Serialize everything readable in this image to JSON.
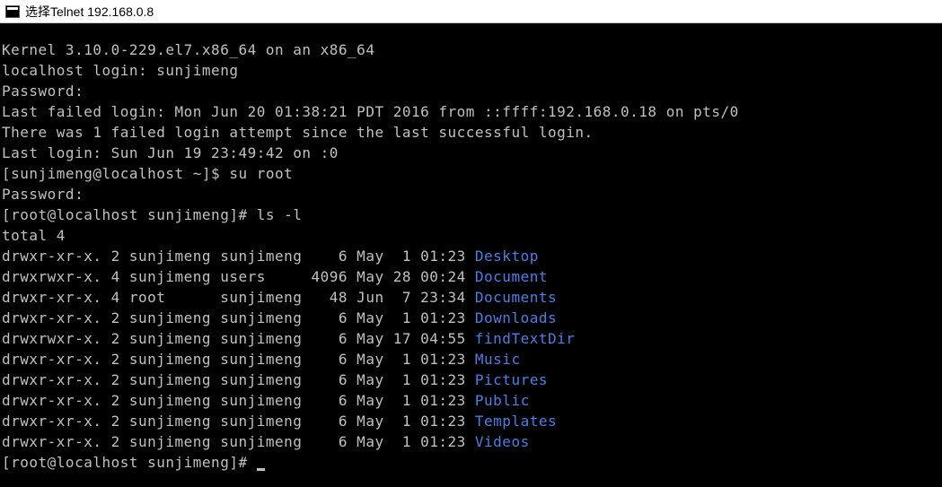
{
  "window": {
    "title": "选择Telnet 192.168.0.8"
  },
  "session": {
    "kernel_line": "Kernel 3.10.0-229.el7.x86_64 on an x86_64",
    "login_prompt": "localhost login: sunjimeng",
    "password_prompt1": "Password:",
    "last_failed": "Last failed login: Mon Jun 20 01:38:21 PDT 2016 from ::ffff:192.168.0.18 on pts/0",
    "failed_attempt": "There was 1 failed login attempt since the last successful login.",
    "last_login": "Last login: Sun Jun 19 23:49:42 on :0",
    "user_prompt": "[sunjimeng@localhost ~]$ su root",
    "password_prompt2": "Password:",
    "root_prompt_ls": "[root@localhost sunjimeng]# ls -l",
    "total_line": "total 4",
    "root_prompt_end": "[root@localhost sunjimeng]# "
  },
  "listing": [
    {
      "perms": "drwxr-xr-x.",
      "links": "2",
      "owner": "sunjimeng",
      "group": "sunjimeng",
      "size": "6",
      "month": "May",
      "day": " 1",
      "time": "01:23",
      "name": "Desktop"
    },
    {
      "perms": "drwxrwxr-x.",
      "links": "4",
      "owner": "sunjimeng",
      "group": "users",
      "size": "4096",
      "month": "May",
      "day": "28",
      "time": "00:24",
      "name": "Document"
    },
    {
      "perms": "drwxr-xr-x.",
      "links": "4",
      "owner": "root",
      "group": "sunjimeng",
      "size": "48",
      "month": "Jun",
      "day": " 7",
      "time": "23:34",
      "name": "Documents"
    },
    {
      "perms": "drwxr-xr-x.",
      "links": "2",
      "owner": "sunjimeng",
      "group": "sunjimeng",
      "size": "6",
      "month": "May",
      "day": " 1",
      "time": "01:23",
      "name": "Downloads"
    },
    {
      "perms": "drwxrwxr-x.",
      "links": "2",
      "owner": "sunjimeng",
      "group": "sunjimeng",
      "size": "6",
      "month": "May",
      "day": "17",
      "time": "04:55",
      "name": "findTextDir"
    },
    {
      "perms": "drwxr-xr-x.",
      "links": "2",
      "owner": "sunjimeng",
      "group": "sunjimeng",
      "size": "6",
      "month": "May",
      "day": " 1",
      "time": "01:23",
      "name": "Music"
    },
    {
      "perms": "drwxr-xr-x.",
      "links": "2",
      "owner": "sunjimeng",
      "group": "sunjimeng",
      "size": "6",
      "month": "May",
      "day": " 1",
      "time": "01:23",
      "name": "Pictures"
    },
    {
      "perms": "drwxr-xr-x.",
      "links": "2",
      "owner": "sunjimeng",
      "group": "sunjimeng",
      "size": "6",
      "month": "May",
      "day": " 1",
      "time": "01:23",
      "name": "Public"
    },
    {
      "perms": "drwxr-xr-x.",
      "links": "2",
      "owner": "sunjimeng",
      "group": "sunjimeng",
      "size": "6",
      "month": "May",
      "day": " 1",
      "time": "01:23",
      "name": "Templates"
    },
    {
      "perms": "drwxr-xr-x.",
      "links": "2",
      "owner": "sunjimeng",
      "group": "sunjimeng",
      "size": "6",
      "month": "May",
      "day": " 1",
      "time": "01:23",
      "name": "Videos"
    }
  ]
}
